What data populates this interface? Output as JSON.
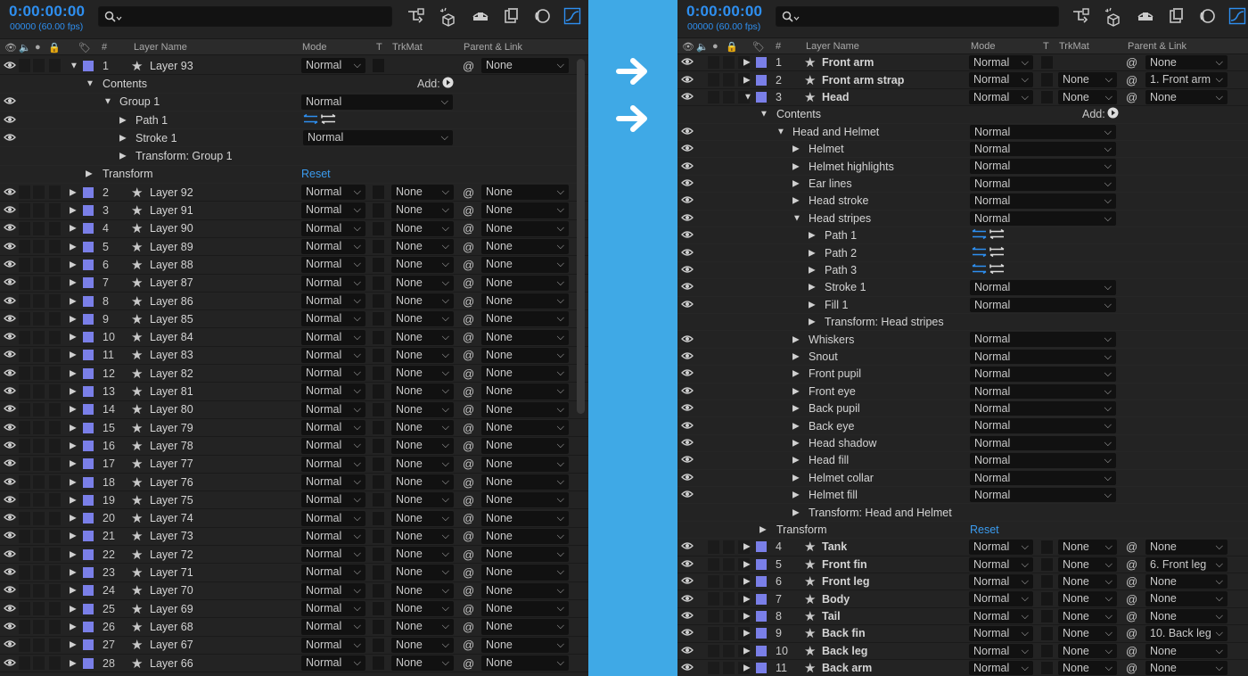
{
  "left": {
    "timecode": "0:00:00:00",
    "fps": "00000 (60.00 fps)",
    "headers": {
      "num": "#",
      "name": "Layer Name",
      "mode": "Mode",
      "t": "T",
      "trkmat": "TrkMat",
      "parent": "Parent & Link"
    },
    "first_layer": {
      "num": "1",
      "name": "Layer 93",
      "mode": "Normal",
      "parent": "None"
    },
    "contents_label": "Contents",
    "add_label": "Add:",
    "group": {
      "name": "Group 1",
      "mode": "Normal"
    },
    "path": "Path 1",
    "stroke": {
      "name": "Stroke 1",
      "mode": "Normal"
    },
    "transform_group": "Transform: Group 1",
    "transform": "Transform",
    "reset": "Reset",
    "layers": [
      {
        "num": "2",
        "name": "Layer 92",
        "mode": "Normal",
        "trkmat": "None",
        "parent": "None"
      },
      {
        "num": "3",
        "name": "Layer 91",
        "mode": "Normal",
        "trkmat": "None",
        "parent": "None"
      },
      {
        "num": "4",
        "name": "Layer 90",
        "mode": "Normal",
        "trkmat": "None",
        "parent": "None"
      },
      {
        "num": "5",
        "name": "Layer 89",
        "mode": "Normal",
        "trkmat": "None",
        "parent": "None"
      },
      {
        "num": "6",
        "name": "Layer 88",
        "mode": "Normal",
        "trkmat": "None",
        "parent": "None"
      },
      {
        "num": "7",
        "name": "Layer 87",
        "mode": "Normal",
        "trkmat": "None",
        "parent": "None"
      },
      {
        "num": "8",
        "name": "Layer 86",
        "mode": "Normal",
        "trkmat": "None",
        "parent": "None"
      },
      {
        "num": "9",
        "name": "Layer 85",
        "mode": "Normal",
        "trkmat": "None",
        "parent": "None"
      },
      {
        "num": "10",
        "name": "Layer 84",
        "mode": "Normal",
        "trkmat": "None",
        "parent": "None"
      },
      {
        "num": "11",
        "name": "Layer 83",
        "mode": "Normal",
        "trkmat": "None",
        "parent": "None"
      },
      {
        "num": "12",
        "name": "Layer 82",
        "mode": "Normal",
        "trkmat": "None",
        "parent": "None"
      },
      {
        "num": "13",
        "name": "Layer 81",
        "mode": "Normal",
        "trkmat": "None",
        "parent": "None"
      },
      {
        "num": "14",
        "name": "Layer 80",
        "mode": "Normal",
        "trkmat": "None",
        "parent": "None"
      },
      {
        "num": "15",
        "name": "Layer 79",
        "mode": "Normal",
        "trkmat": "None",
        "parent": "None"
      },
      {
        "num": "16",
        "name": "Layer 78",
        "mode": "Normal",
        "trkmat": "None",
        "parent": "None"
      },
      {
        "num": "17",
        "name": "Layer 77",
        "mode": "Normal",
        "trkmat": "None",
        "parent": "None"
      },
      {
        "num": "18",
        "name": "Layer 76",
        "mode": "Normal",
        "trkmat": "None",
        "parent": "None"
      },
      {
        "num": "19",
        "name": "Layer 75",
        "mode": "Normal",
        "trkmat": "None",
        "parent": "None"
      },
      {
        "num": "20",
        "name": "Layer 74",
        "mode": "Normal",
        "trkmat": "None",
        "parent": "None"
      },
      {
        "num": "21",
        "name": "Layer 73",
        "mode": "Normal",
        "trkmat": "None",
        "parent": "None"
      },
      {
        "num": "22",
        "name": "Layer 72",
        "mode": "Normal",
        "trkmat": "None",
        "parent": "None"
      },
      {
        "num": "23",
        "name": "Layer 71",
        "mode": "Normal",
        "trkmat": "None",
        "parent": "None"
      },
      {
        "num": "24",
        "name": "Layer 70",
        "mode": "Normal",
        "trkmat": "None",
        "parent": "None"
      },
      {
        "num": "25",
        "name": "Layer 69",
        "mode": "Normal",
        "trkmat": "None",
        "parent": "None"
      },
      {
        "num": "26",
        "name": "Layer 68",
        "mode": "Normal",
        "trkmat": "None",
        "parent": "None"
      },
      {
        "num": "27",
        "name": "Layer 67",
        "mode": "Normal",
        "trkmat": "None",
        "parent": "None"
      },
      {
        "num": "28",
        "name": "Layer 66",
        "mode": "Normal",
        "trkmat": "None",
        "parent": "None"
      }
    ]
  },
  "right": {
    "timecode": "0:00:00:00",
    "fps": "00000 (60.00 fps)",
    "headers": {
      "num": "#",
      "name": "Layer Name",
      "mode": "Mode",
      "t": "T",
      "trkmat": "TrkMat",
      "parent": "Parent & Link"
    },
    "top_layers": [
      {
        "num": "1",
        "name": "Front arm",
        "mode": "Normal",
        "trkmat": "",
        "parent": "None"
      },
      {
        "num": "2",
        "name": "Front arm strap",
        "mode": "Normal",
        "trkmat": "None",
        "parent": "1. Front arm"
      },
      {
        "num": "3",
        "name": "Head",
        "mode": "Normal",
        "trkmat": "None",
        "parent": "None"
      }
    ],
    "contents_label": "Contents",
    "add_label": "Add:",
    "group": {
      "name": "Head and Helmet",
      "mode": "Normal"
    },
    "children_a": [
      {
        "name": "Helmet",
        "mode": "Normal"
      },
      {
        "name": "Helmet highlights",
        "mode": "Normal"
      },
      {
        "name": "Ear lines",
        "mode": "Normal"
      },
      {
        "name": "Head stroke",
        "mode": "Normal"
      }
    ],
    "stripes": {
      "name": "Head stripes",
      "mode": "Normal"
    },
    "paths": [
      "Path 1",
      "Path 2",
      "Path 3"
    ],
    "stroke": {
      "name": "Stroke 1",
      "mode": "Normal"
    },
    "fill": {
      "name": "Fill 1",
      "mode": "Normal"
    },
    "transform_stripes": "Transform: Head stripes",
    "children_b": [
      {
        "name": "Whiskers",
        "mode": "Normal"
      },
      {
        "name": "Snout",
        "mode": "Normal"
      },
      {
        "name": "Front pupil",
        "mode": "Normal"
      },
      {
        "name": "Front eye",
        "mode": "Normal"
      },
      {
        "name": "Back pupil",
        "mode": "Normal"
      },
      {
        "name": "Back eye",
        "mode": "Normal"
      },
      {
        "name": "Head shadow",
        "mode": "Normal"
      },
      {
        "name": "Head fill",
        "mode": "Normal"
      },
      {
        "name": "Helmet collar",
        "mode": "Normal"
      },
      {
        "name": "Helmet fill",
        "mode": "Normal"
      }
    ],
    "transform_group": "Transform: Head and Helmet",
    "transform": "Transform",
    "reset": "Reset",
    "bottom_layers": [
      {
        "num": "4",
        "name": "Tank",
        "mode": "Normal",
        "trkmat": "None",
        "parent": "None"
      },
      {
        "num": "5",
        "name": "Front fin",
        "mode": "Normal",
        "trkmat": "None",
        "parent": "6. Front leg"
      },
      {
        "num": "6",
        "name": "Front leg",
        "mode": "Normal",
        "trkmat": "None",
        "parent": "None"
      },
      {
        "num": "7",
        "name": "Body",
        "mode": "Normal",
        "trkmat": "None",
        "parent": "None"
      },
      {
        "num": "8",
        "name": "Tail",
        "mode": "Normal",
        "trkmat": "None",
        "parent": "None"
      },
      {
        "num": "9",
        "name": "Back fin",
        "mode": "Normal",
        "trkmat": "None",
        "parent": "10. Back leg"
      },
      {
        "num": "10",
        "name": "Back leg",
        "mode": "Normal",
        "trkmat": "None",
        "parent": "None"
      },
      {
        "num": "11",
        "name": "Back arm",
        "mode": "Normal",
        "trkmat": "None",
        "parent": "None"
      }
    ]
  },
  "colors": {
    "accent": "#2e8ff0",
    "label": "#7a7fe8",
    "background": "#3fa9e6"
  }
}
